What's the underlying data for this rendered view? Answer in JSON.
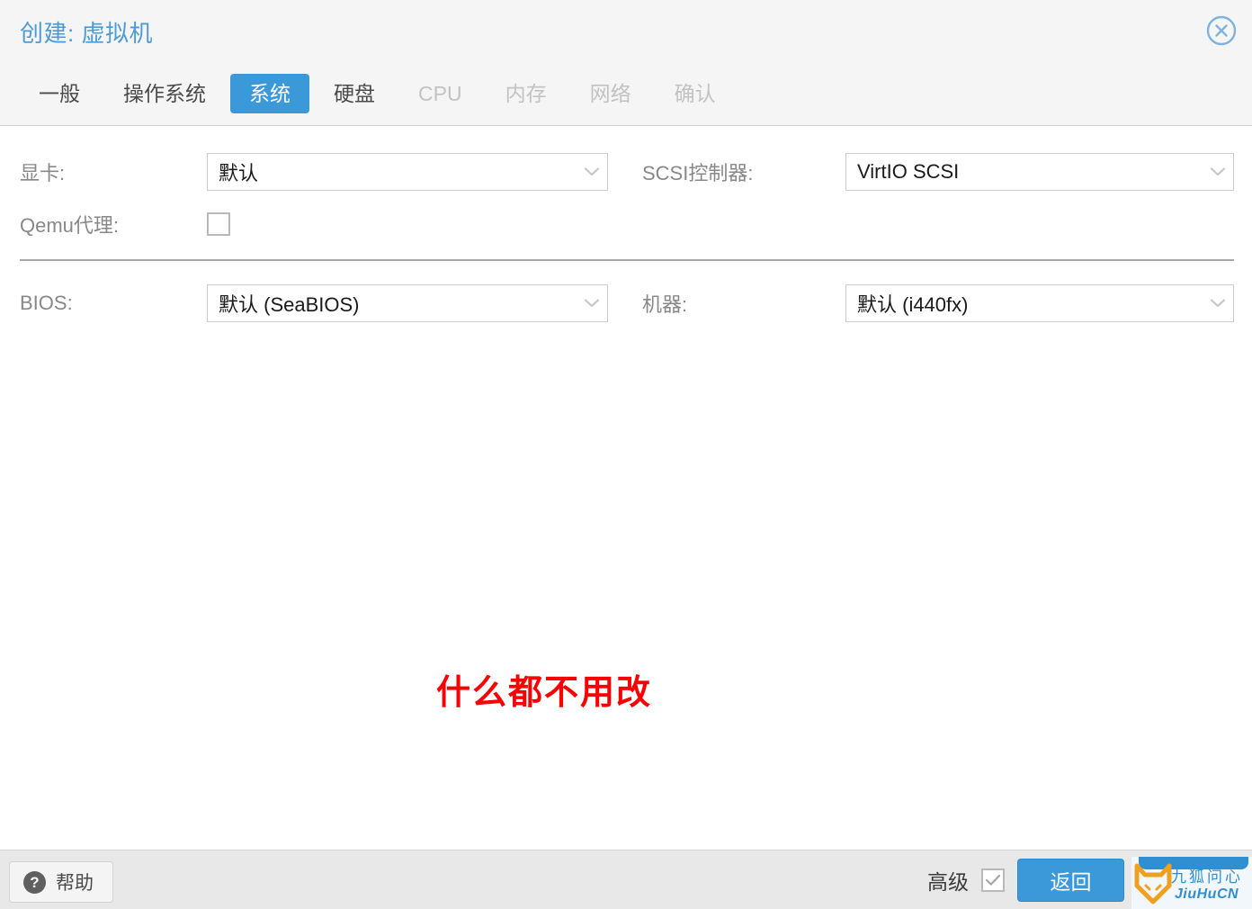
{
  "window": {
    "title": "创建: 虚拟机",
    "close_icon": "close-circle-icon"
  },
  "tabs": [
    {
      "label": "一般",
      "state": "normal"
    },
    {
      "label": "操作系统",
      "state": "normal"
    },
    {
      "label": "系统",
      "state": "active"
    },
    {
      "label": "硬盘",
      "state": "normal"
    },
    {
      "label": "CPU",
      "state": "disabled"
    },
    {
      "label": "内存",
      "state": "disabled"
    },
    {
      "label": "网络",
      "state": "disabled"
    },
    {
      "label": "确认",
      "state": "disabled"
    }
  ],
  "form": {
    "graphics": {
      "label": "显卡:",
      "value": "默认"
    },
    "scsi_controller": {
      "label": "SCSI控制器:",
      "value": "VirtIO SCSI"
    },
    "qemu_agent": {
      "label": "Qemu代理:",
      "checked": false
    },
    "bios": {
      "label": "BIOS:",
      "value": "默认 (SeaBIOS)"
    },
    "machine": {
      "label": "机器:",
      "value": "默认 (i440fx)"
    }
  },
  "annotation": {
    "text": "什么都不用改",
    "color": "#fb0000"
  },
  "footer": {
    "help_label": "帮助",
    "help_icon": "question-mark-icon",
    "advanced_label": "高级",
    "advanced_checked": true,
    "back_label": "返回"
  },
  "watermark": {
    "logo_icon": "fox-head-logo-icon",
    "text_cn": "九狐问心",
    "text_en": "JiuHuCN"
  },
  "colors": {
    "accent": "#3c99d9",
    "title": "#4e9ad4",
    "annotation": "#fb0000",
    "header_bg": "#f5f5f5",
    "footer_bg": "#e8e8e8"
  }
}
